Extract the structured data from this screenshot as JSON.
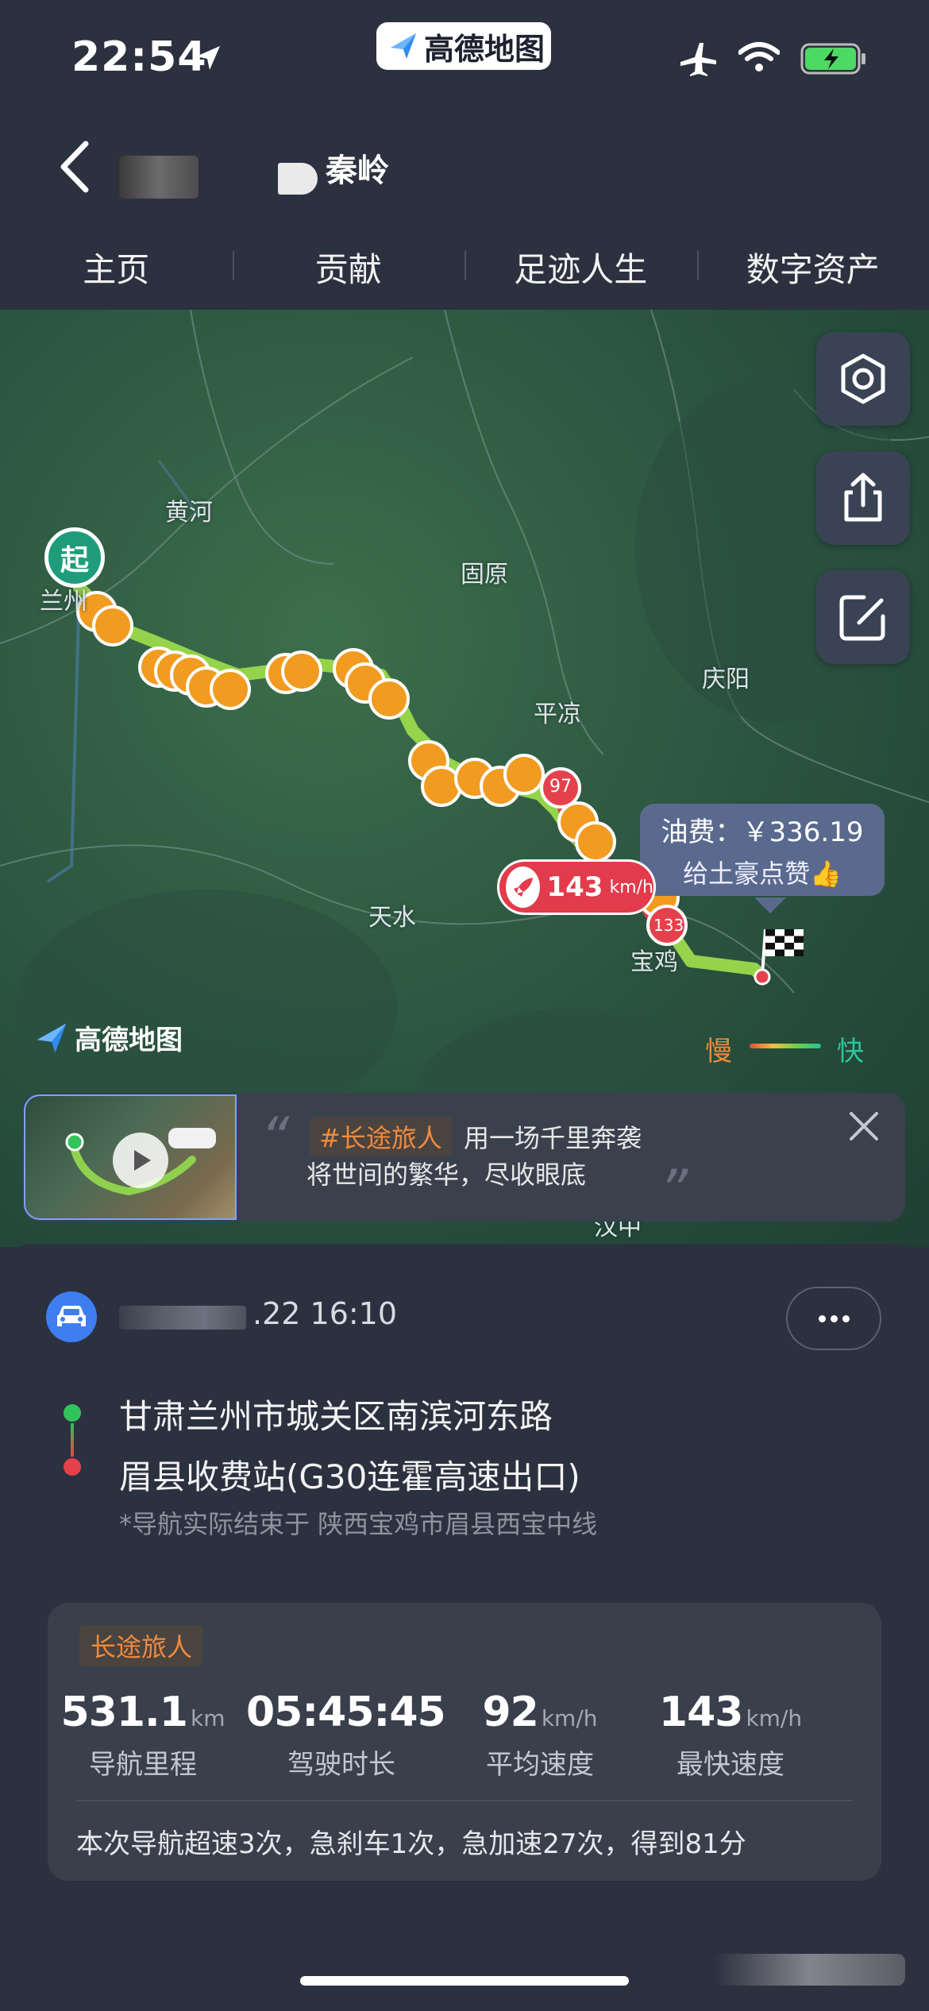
{
  "status_bar": {
    "time": "22:54",
    "app_badge": "高德地图"
  },
  "header": {
    "title": "秦岭",
    "tabs": [
      "主页",
      "贡献",
      "足迹人生",
      "数字资产"
    ]
  },
  "map": {
    "labels": {
      "huanghe": "黄河",
      "lanzhou": "兰州",
      "guyuan": "固原",
      "qingyang": "庆阳",
      "pingliang": "平凉",
      "tianshui": "天水",
      "baoji": "宝鸡",
      "hanzhong": "汉中",
      "badge_97": "97",
      "badge_133": "133"
    },
    "start_marker": "起",
    "fuel_callout": {
      "line1": "油费：￥336.19",
      "line2": "给土豪点赞👍"
    },
    "max_speed_pill": {
      "value": "143",
      "unit": "km/h"
    },
    "watermark": "高德地图",
    "legend": {
      "slow": "慢",
      "fast": "快"
    }
  },
  "banner": {
    "tag": "#长途旅人",
    "line1": "用一场千里奔袭",
    "line2": "将世间的繁华，尽收眼底"
  },
  "trip": {
    "datetime": ".22 16:10",
    "from": "甘肃兰州市城关区南滨河东路",
    "to": "眉县收费站(G30连霍高速出口)",
    "note": "*导航实际结束于 陕西宝鸡市眉县西宝中线"
  },
  "stats": {
    "tag": "长途旅人",
    "items": [
      {
        "value": "531.1",
        "unit": "km",
        "label": "导航里程"
      },
      {
        "value": "05:45:45",
        "unit": "",
        "label": "驾驶时长"
      },
      {
        "value": "92",
        "unit": "km/h",
        "label": "平均速度"
      },
      {
        "value": "143",
        "unit": "km/h",
        "label": "最快速度"
      }
    ],
    "summary": "本次导航超速3次，急刹车1次，急加速27次，得到81分"
  },
  "colors": {
    "background": "#2c3140",
    "accent_orange": "#f08a3c",
    "speed_red": "#e23b4b",
    "start_green": "#1f9d7a",
    "route_green": "#8fd14f"
  }
}
